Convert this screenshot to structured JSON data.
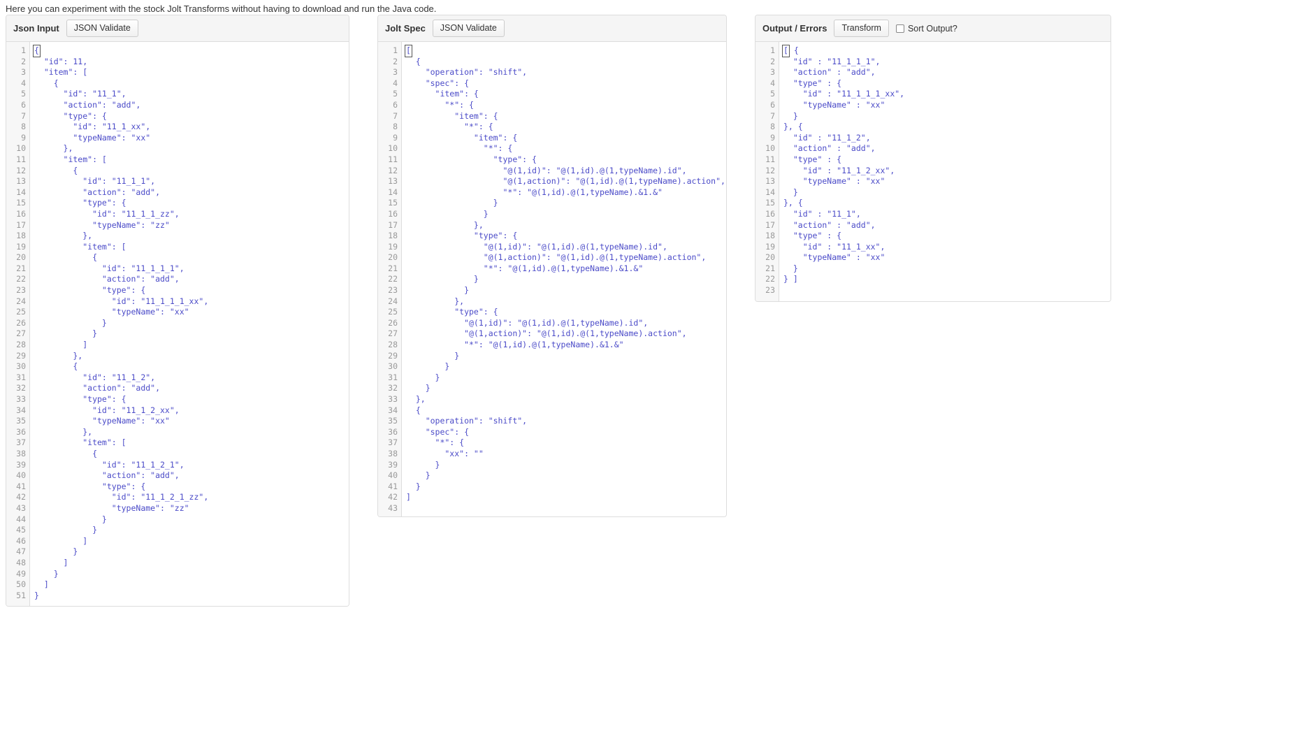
{
  "intro_text": "Here you can experiment with the stock Jolt Transforms without having to download and run the Java code.",
  "accent_code_color": "#4b4bc8",
  "panels": {
    "input": {
      "title": "Json Input",
      "button_label": "JSON Validate",
      "line_count": 51,
      "lines": [
        "{",
        "  \"id\": 11,",
        "  \"item\": [",
        "    {",
        "      \"id\": \"11_1\",",
        "      \"action\": \"add\",",
        "      \"type\": {",
        "        \"id\": \"11_1_xx\",",
        "        \"typeName\": \"xx\"",
        "      },",
        "      \"item\": [",
        "        {",
        "          \"id\": \"11_1_1\",",
        "          \"action\": \"add\",",
        "          \"type\": {",
        "            \"id\": \"11_1_1_zz\",",
        "            \"typeName\": \"zz\"",
        "          },",
        "          \"item\": [",
        "            {",
        "              \"id\": \"11_1_1_1\",",
        "              \"action\": \"add\",",
        "              \"type\": {",
        "                \"id\": \"11_1_1_1_xx\",",
        "                \"typeName\": \"xx\"",
        "              }",
        "            }",
        "          ]",
        "        },",
        "        {",
        "          \"id\": \"11_1_2\",",
        "          \"action\": \"add\",",
        "          \"type\": {",
        "            \"id\": \"11_1_2_xx\",",
        "            \"typeName\": \"xx\"",
        "          },",
        "          \"item\": [",
        "            {",
        "              \"id\": \"11_1_2_1\",",
        "              \"action\": \"add\",",
        "              \"type\": {",
        "                \"id\": \"11_1_2_1_zz\",",
        "                \"typeName\": \"zz\"",
        "              }",
        "            }",
        "          ]",
        "        }",
        "      ]",
        "    }",
        "  ]",
        "}"
      ]
    },
    "spec": {
      "title": "Jolt Spec",
      "button_label": "JSON Validate",
      "line_count": 43,
      "lines": [
        "[",
        "  {",
        "    \"operation\": \"shift\",",
        "    \"spec\": {",
        "      \"item\": {",
        "        \"*\": {",
        "          \"item\": {",
        "            \"*\": {",
        "              \"item\": {",
        "                \"*\": {",
        "                  \"type\": {",
        "                    \"@(1,id)\": \"@(1,id).@(1,typeName).id\",",
        "                    \"@(1,action)\": \"@(1,id).@(1,typeName).action\",",
        "                    \"*\": \"@(1,id).@(1,typeName).&1.&\"",
        "                  }",
        "                }",
        "              },",
        "              \"type\": {",
        "                \"@(1,id)\": \"@(1,id).@(1,typeName).id\",",
        "                \"@(1,action)\": \"@(1,id).@(1,typeName).action\",",
        "                \"*\": \"@(1,id).@(1,typeName).&1.&\"",
        "              }",
        "            }",
        "          },",
        "          \"type\": {",
        "            \"@(1,id)\": \"@(1,id).@(1,typeName).id\",",
        "            \"@(1,action)\": \"@(1,id).@(1,typeName).action\",",
        "            \"*\": \"@(1,id).@(1,typeName).&1.&\"",
        "          }",
        "        }",
        "      }",
        "    }",
        "  },",
        "  {",
        "    \"operation\": \"shift\",",
        "    \"spec\": {",
        "      \"*\": {",
        "        \"xx\": \"\"",
        "      }",
        "    }",
        "  }",
        "]"
      ]
    },
    "output": {
      "title": "Output / Errors",
      "button_label": "Transform",
      "sort_checkbox_label": "Sort Output?",
      "sort_checked": false,
      "line_count": 23,
      "lines": [
        "[ {",
        "  \"id\" : \"11_1_1_1\",",
        "  \"action\" : \"add\",",
        "  \"type\" : {",
        "    \"id\" : \"11_1_1_1_xx\",",
        "    \"typeName\" : \"xx\"",
        "  }",
        "}, {",
        "  \"id\" : \"11_1_2\",",
        "  \"action\" : \"add\",",
        "  \"type\" : {",
        "    \"id\" : \"11_1_2_xx\",",
        "    \"typeName\" : \"xx\"",
        "  }",
        "}, {",
        "  \"id\" : \"11_1\",",
        "  \"action\" : \"add\",",
        "  \"type\" : {",
        "    \"id\" : \"11_1_xx\",",
        "    \"typeName\" : \"xx\"",
        "  }",
        "} ]"
      ]
    }
  }
}
